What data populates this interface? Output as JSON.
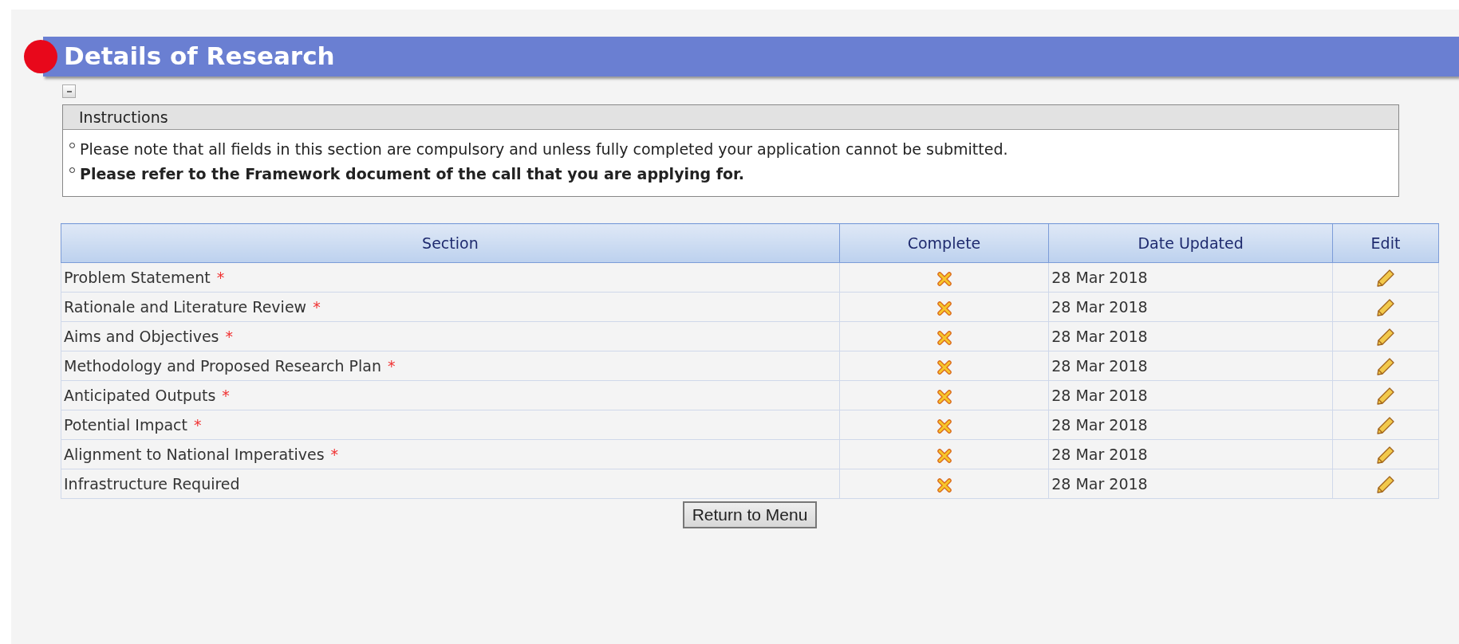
{
  "page": {
    "title": "Details of Research",
    "collapsed": false
  },
  "instructions": {
    "title": "Instructions",
    "items": [
      {
        "text": "Please note that all fields in this section are compulsory and unless fully completed your application cannot be submitted.",
        "bold": false
      },
      {
        "text": "Please refer to the Framework document of the call that you are applying for.",
        "bold": true
      }
    ]
  },
  "table": {
    "required_mark": "*",
    "columns": [
      "Section",
      "Complete",
      "Date Updated",
      "Edit"
    ],
    "rows": [
      {
        "section": "Problem Statement",
        "required": true,
        "complete": false,
        "date": "28 Mar 2018"
      },
      {
        "section": "Rationale and Literature Review",
        "required": true,
        "complete": false,
        "date": "28 Mar 2018"
      },
      {
        "section": "Aims and Objectives",
        "required": true,
        "complete": false,
        "date": "28 Mar 2018"
      },
      {
        "section": "Methodology and Proposed Research Plan",
        "required": true,
        "complete": false,
        "date": "28 Mar 2018"
      },
      {
        "section": "Anticipated Outputs",
        "required": true,
        "complete": false,
        "date": "28 Mar 2018"
      },
      {
        "section": "Potential Impact",
        "required": true,
        "complete": false,
        "date": "28 Mar 2018"
      },
      {
        "section": "Alignment to National Imperatives",
        "required": true,
        "complete": false,
        "date": "28 Mar 2018"
      },
      {
        "section": "Infrastructure Required",
        "required": false,
        "complete": false,
        "date": "28 Mar 2018"
      }
    ]
  },
  "buttons": [
    "Return to Menu"
  ]
}
